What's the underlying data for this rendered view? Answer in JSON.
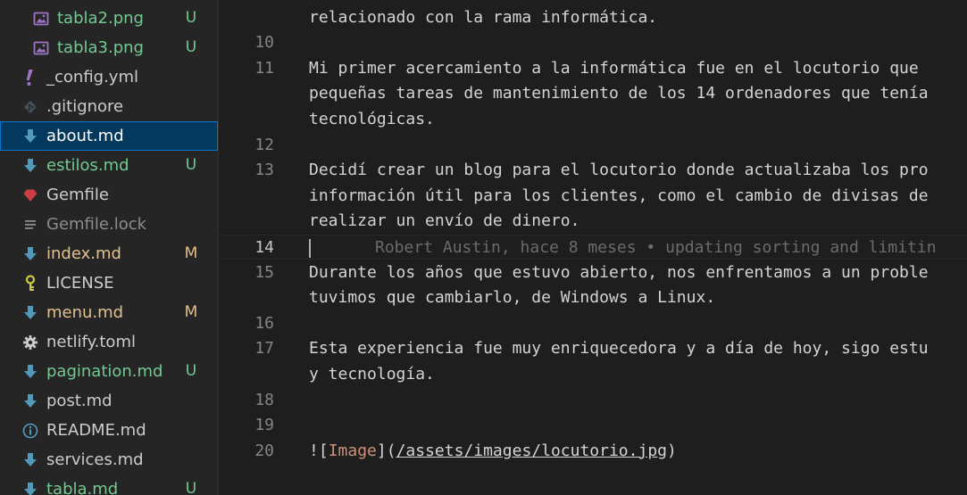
{
  "explorer": {
    "files": [
      {
        "name": "tabla2.png",
        "icon": "image-icon",
        "icon_color": "#a074c4",
        "status": "U",
        "status_color": "#73c991",
        "indented": true
      },
      {
        "name": "tabla3.png",
        "icon": "image-icon",
        "icon_color": "#a074c4",
        "status": "U",
        "status_color": "#73c991",
        "indented": true
      },
      {
        "name": "_config.yml",
        "icon": "exclamation-icon",
        "icon_color": "#a074c4",
        "status": "",
        "indented": false
      },
      {
        "name": ".gitignore",
        "icon": "git-icon",
        "icon_color": "#41535b",
        "status": "",
        "indented": false
      },
      {
        "name": "about.md",
        "icon": "markdown-icon",
        "icon_color": "#519aba",
        "status": "",
        "indented": false,
        "selected": true
      },
      {
        "name": "estilos.md",
        "icon": "markdown-icon",
        "icon_color": "#519aba",
        "status": "U",
        "status_color": "#73c991",
        "indented": false
      },
      {
        "name": "Gemfile",
        "icon": "ruby-icon",
        "icon_color": "#cc3e44",
        "status": "",
        "indented": false
      },
      {
        "name": "Gemfile.lock",
        "icon": "lines-icon",
        "icon_color": "#8c8c8c",
        "status": "",
        "indented": false,
        "ignored": true
      },
      {
        "name": "index.md",
        "icon": "markdown-icon",
        "icon_color": "#519aba",
        "status": "M",
        "status_color": "#e2c08d",
        "indented": false
      },
      {
        "name": "LICENSE",
        "icon": "key-icon",
        "icon_color": "#cbcb41",
        "status": "",
        "indented": false
      },
      {
        "name": "menu.md",
        "icon": "markdown-icon",
        "icon_color": "#519aba",
        "status": "M",
        "status_color": "#e2c08d",
        "indented": false
      },
      {
        "name": "netlify.toml",
        "icon": "gear-icon",
        "icon_color": "#cccccc",
        "status": "",
        "indented": false
      },
      {
        "name": "pagination.md",
        "icon": "markdown-icon",
        "icon_color": "#519aba",
        "status": "U",
        "status_color": "#73c991",
        "indented": false
      },
      {
        "name": "post.md",
        "icon": "markdown-icon",
        "icon_color": "#519aba",
        "status": "",
        "indented": false
      },
      {
        "name": "README.md",
        "icon": "info-icon",
        "icon_color": "#519aba",
        "status": "",
        "indented": false
      },
      {
        "name": "services.md",
        "icon": "markdown-icon",
        "icon_color": "#519aba",
        "status": "",
        "indented": false
      },
      {
        "name": "tabla.md",
        "icon": "markdown-icon",
        "icon_color": "#519aba",
        "status": "U",
        "status_color": "#73c991",
        "indented": false
      }
    ]
  },
  "editor": {
    "lines": [
      {
        "number": "",
        "text": "relacionado con la rama informática."
      },
      {
        "number": "10",
        "text": ""
      },
      {
        "number": "11",
        "text": "Mi primer acercamiento a la informática fue en el locutorio que"
      },
      {
        "number": "",
        "text": "pequeñas tareas de mantenimiento de los 14 ordenadores que tenía"
      },
      {
        "number": "",
        "text": "tecnológicas."
      },
      {
        "number": "12",
        "text": ""
      },
      {
        "number": "13",
        "text": "Decidí crear un blog para el locutorio donde actualizaba los pro"
      },
      {
        "number": "",
        "text": "información útil para los clientes, como el cambio de divisas de"
      },
      {
        "number": "",
        "text": "realizar un envío de dinero."
      },
      {
        "number": "14",
        "text": "",
        "active": true,
        "blame": "Robert Austin, hace 8 meses • updating sorting and limitin"
      },
      {
        "number": "15",
        "text": "Durante los años que estuvo abierto, nos enfrentamos a un proble"
      },
      {
        "number": "",
        "text": "tuvimos que cambiarlo, de Windows a Linux."
      },
      {
        "number": "16",
        "text": ""
      },
      {
        "number": "17",
        "text": "Esta experiencia fue muy enriquecedora y a día de hoy, sigo estu"
      },
      {
        "number": "",
        "text": "y tecnología."
      },
      {
        "number": "18",
        "text": ""
      },
      {
        "number": "19",
        "text": ""
      },
      {
        "number": "20",
        "image_link": {
          "open": "![",
          "alt": "Image",
          "mid": "](",
          "url": "/assets/images/locutorio.jpg",
          "close": ")"
        }
      }
    ]
  },
  "colors": {
    "sidebar_bg": "#252526",
    "editor_bg": "#1e1e1e",
    "selection_bg": "#04395e",
    "selection_border": "#0078d4",
    "untracked": "#73c991",
    "modified": "#e2c08d"
  }
}
